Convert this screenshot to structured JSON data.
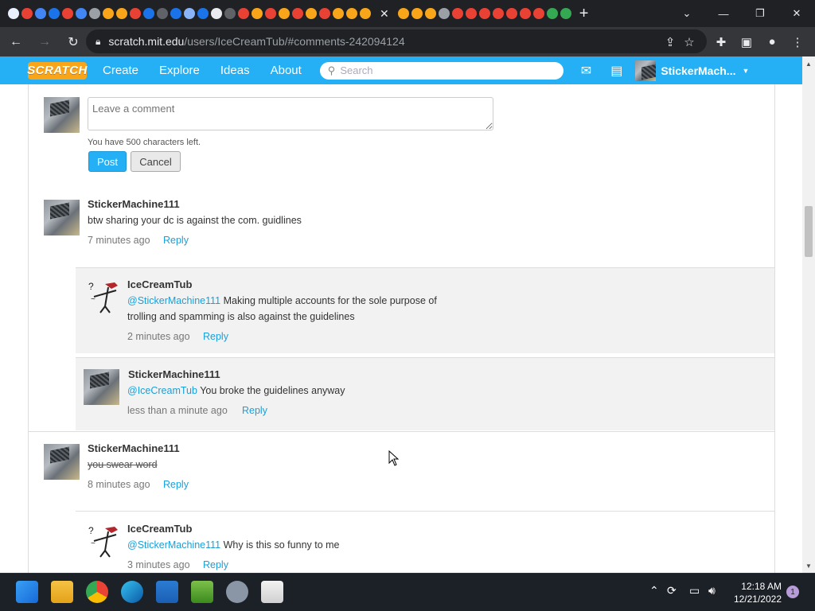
{
  "browser": {
    "url_host": "scratch.mit.edu",
    "url_path": "/users/IceCreamTub/#comments-242094124",
    "tab_colors": [
      "#e8f0fe",
      "#e94235",
      "#4285f4",
      "#1a73e8",
      "#e94235",
      "#4285f4",
      "#9aa0a6",
      "#f9a51a",
      "#f9a51a",
      "#e94235",
      "#1a73e8",
      "#5f6368",
      "#1a73e8",
      "#8ab4f8",
      "#1a73e8",
      "#e8eaed",
      "#5f6368",
      "#e94235",
      "#f9a51a",
      "#e94235",
      "#f9a51a",
      "#e94235",
      "#f9a51a",
      "#e94235",
      "#f9a51a",
      "#f9a51a",
      "#f9a51a"
    ],
    "tab_colors_right": [
      "#f9a51a",
      "#f9a51a",
      "#f9a51a",
      "#9aa0a6",
      "#e94235",
      "#e94235",
      "#e94235",
      "#e94235",
      "#e94235",
      "#e94235",
      "#e94235",
      "#34a853",
      "#34a853"
    ]
  },
  "scratch_nav": {
    "logo": "SCRATCH",
    "links": [
      "Create",
      "Explore",
      "Ideas",
      "About"
    ],
    "search_placeholder": "Search",
    "username": "StickerMach..."
  },
  "composer": {
    "placeholder": "Leave a comment",
    "chars_left": "You have 500 characters left.",
    "post_label": "Post",
    "cancel_label": "Cancel"
  },
  "comments": [
    {
      "user": "StickerMachine111",
      "text": "btw sharing your dc is against the com. guidlines",
      "time": "7 minutes ago",
      "reply": "Reply",
      "replies": [
        {
          "user": "IceCreamTub",
          "mention": "@StickerMachine111",
          "text": " Making multiple accounts for the sole purpose of trolling and spamming is also against the guidelines",
          "time": "2 minutes ago",
          "reply": "Reply"
        },
        {
          "user": "StickerMachine111",
          "mention": "@IceCreamTub",
          "text": " You broke the guidelines anyway",
          "time": "less than a minute ago",
          "reply": "Reply"
        }
      ]
    },
    {
      "user": "StickerMachine111",
      "text": "you swear word",
      "time": "8 minutes ago",
      "reply": "Reply",
      "replies": [
        {
          "user": "IceCreamTub",
          "mention": "@StickerMachine111",
          "text": " Why is this so funny to me",
          "time": "3 minutes ago",
          "reply": "Reply"
        }
      ]
    }
  ],
  "taskbar": {
    "time": "12:18 AM",
    "date": "12/21/2022",
    "notifications": "1"
  }
}
